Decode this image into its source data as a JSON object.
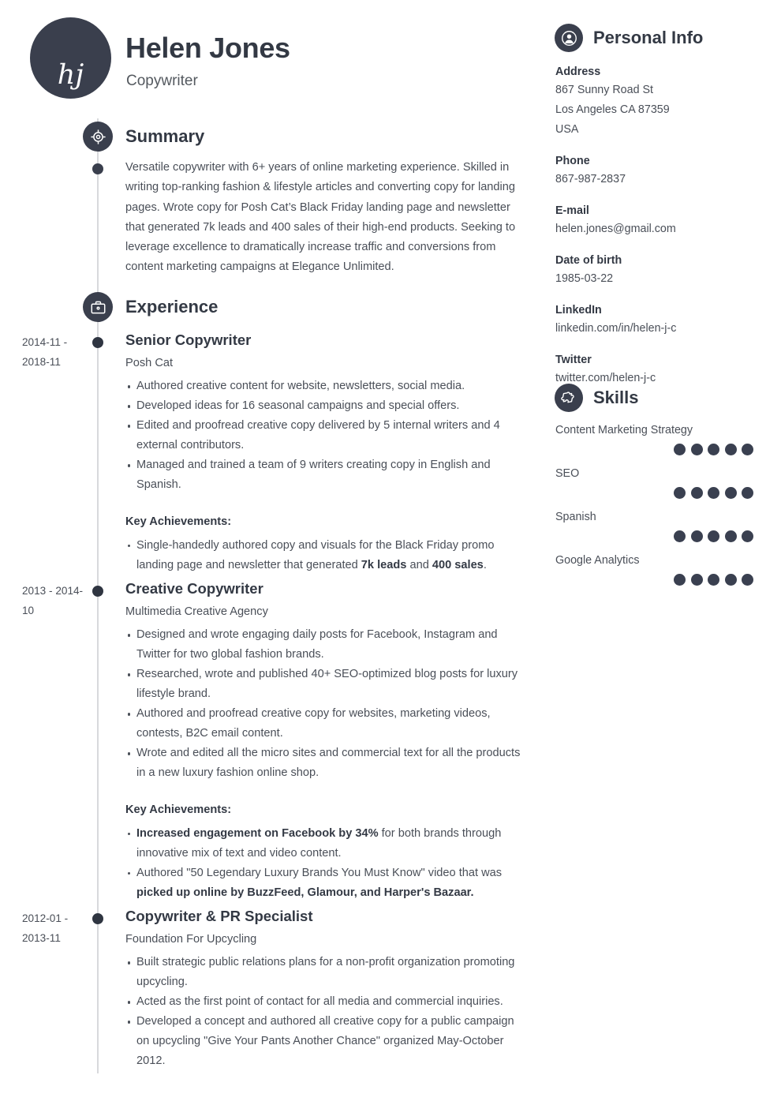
{
  "header": {
    "monogram": "hj",
    "name": "Helen Jones",
    "job_title": "Copywriter"
  },
  "summary": {
    "heading": "Summary",
    "icon": "target-icon",
    "text": "Versatile copywriter with 6+ years of online marketing experience. Skilled in writing top-ranking fashion & lifestyle articles and converting copy for landing pages. Wrote copy for Posh Cat’s Black Friday landing page and newsletter that generated 7k leads and 400 sales of their high-end products. Seeking to leverage excellence to dramatically increase traffic and conversions from content marketing campaigns at Elegance Unlimited."
  },
  "experience": {
    "heading": "Experience",
    "icon": "briefcase-icon",
    "achievements_label": "Key Achievements:",
    "jobs": [
      {
        "dates": "2014-11 - 2018-11",
        "role": "Senior Copywriter",
        "company": "Posh Cat",
        "bullets": [
          "Authored creative content for website, newsletters, social media.",
          "Developed ideas for 16 seasonal campaigns and special offers.",
          "Edited and proofread creative copy delivered by 5 internal writers and 4 external contributors.",
          "Managed and trained a team of 9 writers creating copy in English and Spanish."
        ],
        "achievements_html": [
          "Single-handedly authored copy and visuals for the Black Friday promo landing page and newsletter that generated <b>7k leads</b> and <b>400 sales</b>."
        ]
      },
      {
        "dates": "2013 - 2014-10",
        "role": "Creative Copywriter",
        "company": "Multimedia Creative Agency",
        "bullets": [
          "Designed and wrote engaging daily posts for Facebook, Instagram and Twitter for two global fashion brands.",
          "Researched, wrote and published 40+ SEO-optimized blog posts for luxury lifestyle brand.",
          "Authored and proofread creative copy for websites, marketing videos, contests, B2C email content.",
          "Wrote and edited all the micro sites and commercial text for all the products in a new luxury fashion online shop."
        ],
        "achievements_html": [
          "<b>Increased engagement on Facebook by 34%</b> for both brands through innovative mix of text and video content.",
          "Authored \"50 Legendary Luxury Brands You Must Know\" video that was <b>picked up online by BuzzFeed, Glamour, and Harper's Bazaar.</b>"
        ]
      },
      {
        "dates": "2012-01 - 2013-11",
        "role": "Copywriter & PR Specialist",
        "company": "Foundation For Upcycling",
        "bullets": [
          "Built strategic public relations plans for a non-profit organization promoting upcycling.",
          "Acted as the first point of contact for all media and commercial inquiries.",
          "Developed a concept and authored all creative copy for a public campaign on upcycling \"Give Your Pants Another Chance\" organized May-October 2012."
        ],
        "achievements_html": []
      }
    ]
  },
  "personal_info": {
    "heading": "Personal Info",
    "icon": "person-icon",
    "fields": [
      {
        "label": "Address",
        "values": [
          "867 Sunny Road St",
          "Los Angeles CA 87359",
          "USA"
        ]
      },
      {
        "label": "Phone",
        "values": [
          "867-987-2837"
        ]
      },
      {
        "label": "E-mail",
        "values": [
          "helen.jones@gmail.com"
        ]
      },
      {
        "label": "Date of birth",
        "values": [
          "1985-03-22"
        ]
      },
      {
        "label": "LinkedIn",
        "values": [
          "linkedin.com/in/helen-j-c"
        ]
      },
      {
        "label": "Twitter",
        "values": [
          "twitter.com/helen-j-c"
        ]
      }
    ]
  },
  "skills": {
    "heading": "Skills",
    "icon": "puzzle-icon",
    "max_rating": 5,
    "items": [
      {
        "name": "Content Marketing Strategy",
        "rating": 5
      },
      {
        "name": "SEO",
        "rating": 5
      },
      {
        "name": "Spanish",
        "rating": 5
      },
      {
        "name": "Google Analytics",
        "rating": 5
      }
    ]
  },
  "colors": {
    "accent_dark": "#3a3f4d",
    "heading": "#333944",
    "body_text": "#4a4f58",
    "rail": "#d8d9dc",
    "dot_filled": "#3a4050",
    "dot_empty": "#ccced3"
  }
}
